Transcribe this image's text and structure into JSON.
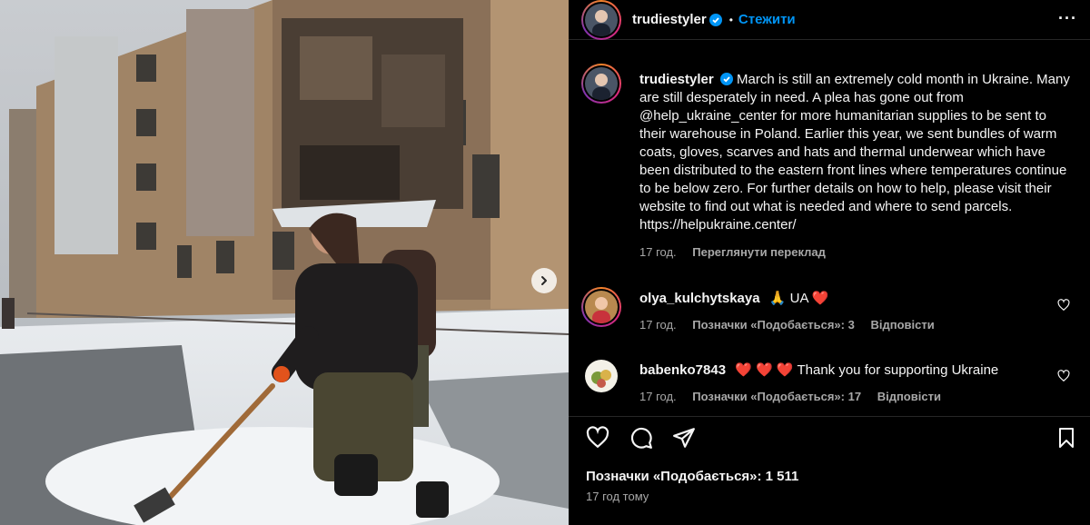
{
  "post": {
    "author": "trudiestyler",
    "follow_label": "Стежити",
    "dot": "•",
    "more_label": "···",
    "caption": "March is still an extremely cold month in Ukraine. Many are still desperately in need. A plea has gone out from @help_ukraine_center for more humanitarian supplies to be sent to their warehouse in Poland. Earlier this year, we sent bundles of warm coats, gloves, scarves and hats and thermal underwear which have been distributed to the eastern front lines where temperatures continue to be below zero. For further details on how to help, please visit their website to find out what is needed and where to send parcels. https://helpukraine.center/",
    "caption_time": "17 год.",
    "translate_label": "Переглянути переклад",
    "likes_label": "Позначки «Подобається»: 1 511",
    "posted_ago": "17 год тому"
  },
  "comments": [
    {
      "username": "olya_kulchytskaya",
      "text": "🙏 UA ❤️",
      "time": "17 год.",
      "likes": "Позначки «Подобається»: 3",
      "reply_label": "Відповісти"
    },
    {
      "username": "babenko7843",
      "text": "❤️ ❤️ ❤️ Thank you for supporting Ukraine",
      "time": "17 год.",
      "likes": "Позначки «Подобається»: 17",
      "reply_label": "Відповісти"
    }
  ],
  "icons": {
    "like": "heart-icon",
    "comment": "comment-icon",
    "share": "share-icon",
    "save": "bookmark-icon",
    "verified": "verified-badge-icon",
    "next": "chevron-right-icon"
  },
  "colors": {
    "background": "#000000",
    "link": "#0095f6",
    "verified": "#0095f6",
    "secondary_text": "#a8a8a8"
  }
}
